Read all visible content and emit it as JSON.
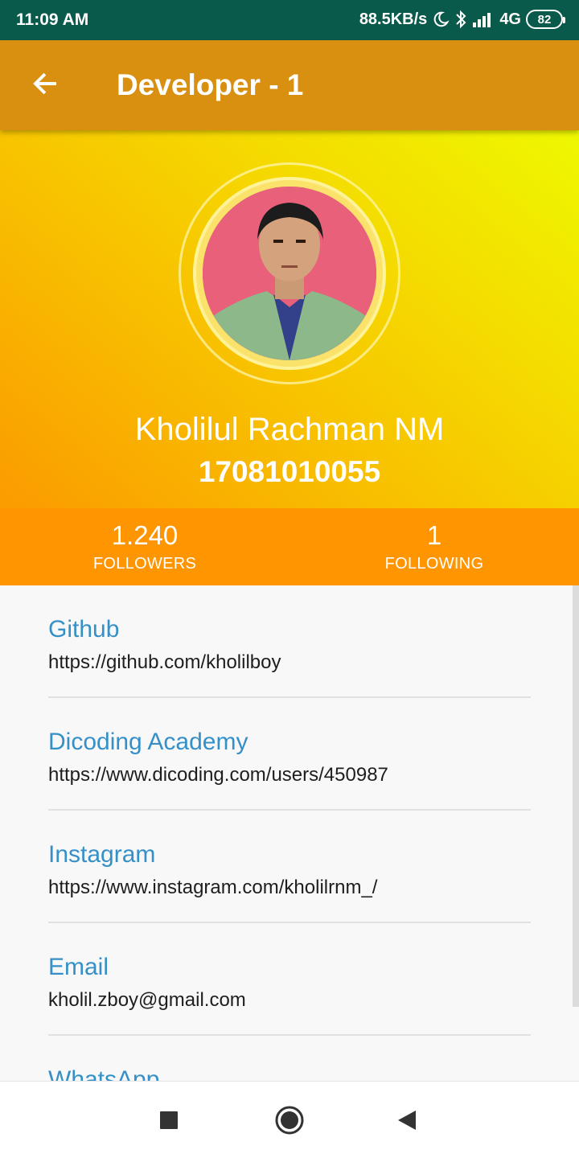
{
  "status_bar": {
    "time": "11:09 AM",
    "net_speed": "88.5KB/s",
    "network": "4G",
    "battery": "82",
    "icons": [
      "moon-icon",
      "bluetooth-icon",
      "signal-icon"
    ]
  },
  "app_bar": {
    "title": "Developer - 1",
    "back_icon": "arrow-left-icon"
  },
  "profile": {
    "name": "Kholilul Rachman NM",
    "id": "17081010055"
  },
  "stats": [
    {
      "value": "1.240",
      "label": "FOLLOWERS"
    },
    {
      "value": "1",
      "label": "FOLLOWING"
    }
  ],
  "links": [
    {
      "title": "Github",
      "value": "https://github.com/kholilboy"
    },
    {
      "title": "Dicoding Academy",
      "value": "https://www.dicoding.com/users/450987"
    },
    {
      "title": "Instagram",
      "value": "https://www.instagram.com/kholilrnm_/"
    },
    {
      "title": "Email",
      "value": "kholil.zboy@gmail.com"
    },
    {
      "title": "WhatsApp",
      "value": ""
    }
  ],
  "nav": [
    "recents-square-icon",
    "home-circle-icon",
    "back-triangle-icon"
  ],
  "colors": {
    "status_bar": "#0a5a4c",
    "app_bar": "#d98f10",
    "stats_bar": "#ff9500",
    "link_title": "#3590c8"
  }
}
